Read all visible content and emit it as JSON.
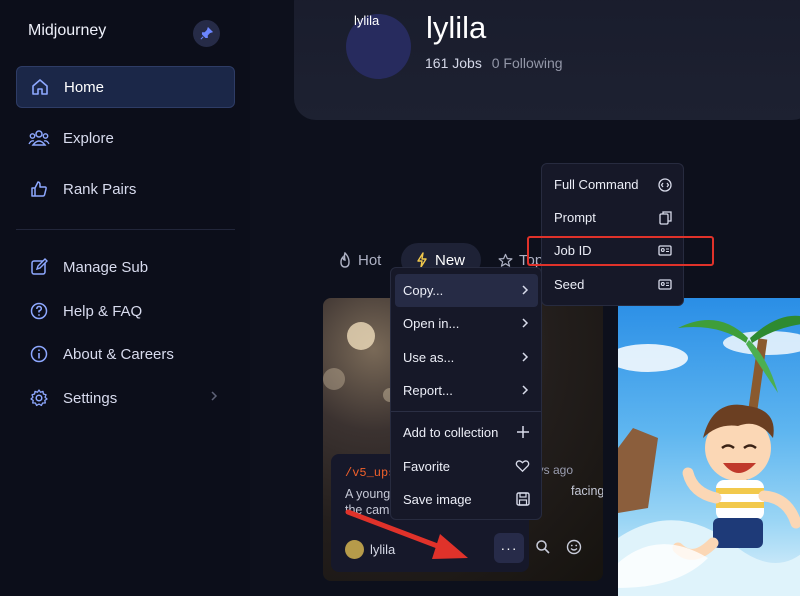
{
  "sidebar": {
    "brand": "Midjourney",
    "items": [
      {
        "label": "Home",
        "icon": "home-icon"
      },
      {
        "label": "Explore",
        "icon": "people-icon"
      },
      {
        "label": "Rank Pairs",
        "icon": "thumbs-up-icon"
      },
      {
        "label": "Manage Sub",
        "icon": "edit-icon"
      },
      {
        "label": "Help & FAQ",
        "icon": "help-icon"
      },
      {
        "label": "About & Careers",
        "icon": "info-icon"
      },
      {
        "label": "Settings",
        "icon": "gear-icon"
      }
    ],
    "active": "Home"
  },
  "profile": {
    "avatar_text": "lylila",
    "name": "lylila",
    "jobs": "161 Jobs",
    "following": "0 Following"
  },
  "tabs": [
    {
      "label": "Hot",
      "icon": "fire-icon"
    },
    {
      "label": "New",
      "icon": "lightning-icon"
    },
    {
      "label": "Top",
      "icon": "star-icon"
    }
  ],
  "card": {
    "tag": "/v5_ups",
    "days_ago": "ays ago",
    "text_line1": "A young",
    "text_line1_end": "facing",
    "text_line2": "the cam",
    "username": "lylila",
    "more_label": "···"
  },
  "menu": {
    "items": [
      {
        "label": "Copy...",
        "trail": "chevron-right-icon"
      },
      {
        "label": "Open in...",
        "trail": "chevron-right-icon"
      },
      {
        "label": "Use as...",
        "trail": "chevron-right-icon"
      },
      {
        "label": "Report...",
        "trail": "chevron-right-icon"
      },
      {
        "label": "Add to collection",
        "trail": "plus-icon"
      },
      {
        "label": "Favorite",
        "trail": "heart-icon"
      },
      {
        "label": "Save image",
        "trail": "save-icon"
      }
    ],
    "highlighted": "Copy..."
  },
  "submenu": {
    "items": [
      {
        "label": "Full Command",
        "trail": "code-icon"
      },
      {
        "label": "Prompt",
        "trail": "copy-icon"
      },
      {
        "label": "Job ID",
        "trail": "id-card-icon"
      },
      {
        "label": "Seed",
        "trail": "id-card-icon"
      }
    ],
    "highlighted_annotation": "Job ID"
  },
  "colors": {
    "background": "#0c0e1a",
    "active_nav": "#1b2748",
    "annotation_red": "#e0322a",
    "tag_orange": "#f0602b"
  }
}
